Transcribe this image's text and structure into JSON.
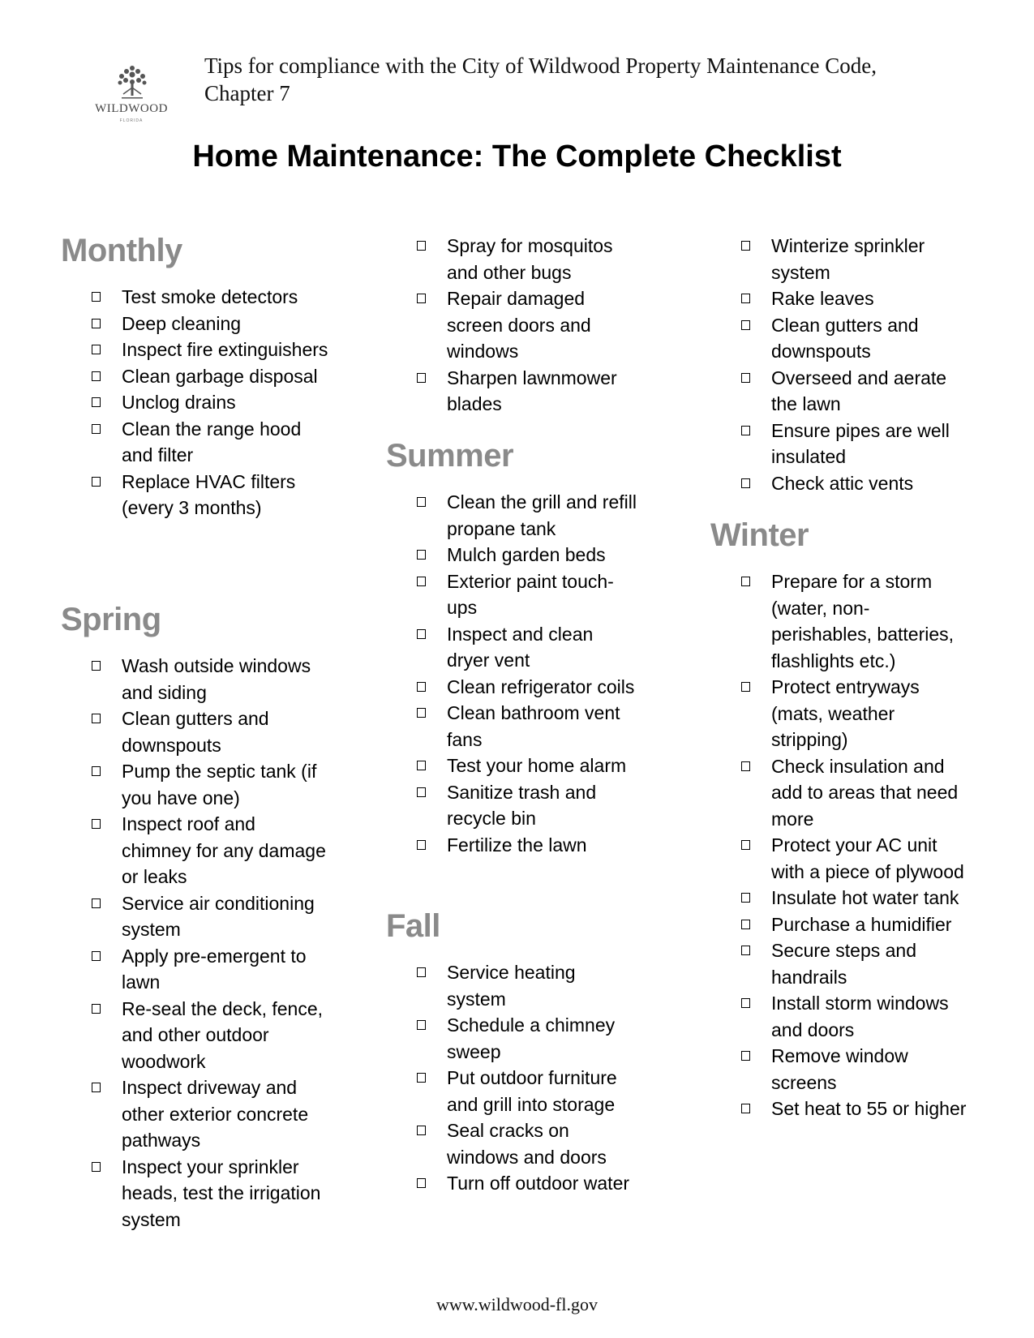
{
  "header": {
    "logo_text": "WILDWOOD",
    "logo_subtext": "FLORIDA",
    "subtitle": "Tips for compliance with the City of Wildwood Property Maintenance Code, Chapter 7",
    "title": "Home Maintenance: The Complete Checklist"
  },
  "sections": {
    "monthly": {
      "heading": "Monthly",
      "items": [
        "Test smoke detectors",
        "Deep cleaning",
        "Inspect fire extinguishers",
        "Clean garbage disposal",
        "Unclog drains",
        "Clean the range hood and filter",
        "Replace HVAC filters (every 3 months)"
      ]
    },
    "spring": {
      "heading": "Spring",
      "items": [
        "Wash outside windows and siding",
        "Clean gutters and downspouts",
        "Pump the septic tank (if you have one)",
        "Inspect roof and chimney for any damage or leaks",
        "Service air conditioning system",
        "Apply pre-emergent to lawn",
        "Re-seal the deck, fence, and other outdoor woodwork",
        "Inspect driveway and other exterior concrete pathways",
        "Inspect your sprinkler heads, test the irrigation system",
        "Spray for mosquitos and other bugs",
        "Repair damaged screen doors and windows",
        "Sharpen lawnmower blades"
      ]
    },
    "summer": {
      "heading": "Summer",
      "items": [
        "Clean the grill and refill propane tank",
        "Mulch garden beds",
        "Exterior paint touch-ups",
        "Inspect and clean dryer vent",
        "Clean refrigerator coils",
        "Clean bathroom vent fans",
        "Test your home alarm",
        "Sanitize trash and recycle bin",
        "Fertilize the lawn"
      ]
    },
    "fall": {
      "heading": "Fall",
      "items": [
        "Service heating system",
        "Schedule a chimney sweep",
        "Put outdoor furniture and grill into storage",
        "Seal cracks on windows and doors",
        "Turn off outdoor water",
        "Winterize sprinkler system",
        "Rake leaves",
        "Clean gutters and downspouts",
        "Overseed and aerate the lawn",
        "Ensure pipes are well insulated",
        "Check attic vents"
      ]
    },
    "winter": {
      "heading": "Winter",
      "items": [
        "Prepare for a storm (water, non-perishables, batteries, flashlights etc.)",
        "Protect entryways (mats, weather stripping)",
        "Check insulation and add to areas that need more",
        "Protect your AC unit with a piece of plywood",
        "Insulate hot water tank",
        "Purchase a humidifier",
        "Secure steps and handrails",
        "Install storm windows and doors",
        "Remove window screens",
        "Set heat to 55 or higher"
      ]
    }
  },
  "footer": {
    "url": "www.wildwood-fl.gov"
  },
  "colors": {
    "heading_gray": "#8a8a8a",
    "text": "#000000"
  }
}
